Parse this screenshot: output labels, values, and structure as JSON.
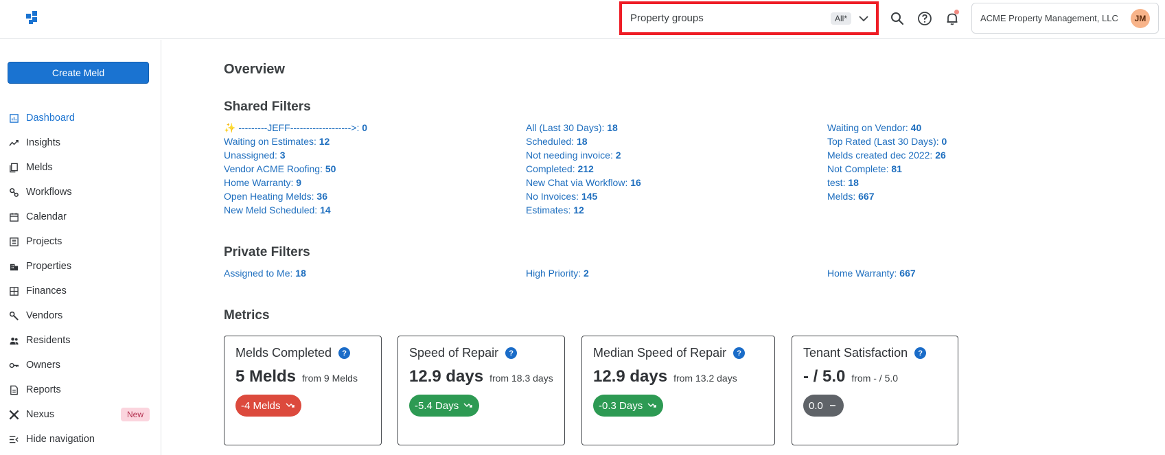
{
  "header": {
    "property_groups_label": "Property groups",
    "property_groups_badge": "All*",
    "account_name": "ACME Property Management, LLC",
    "avatar_initials": "JM"
  },
  "sidebar": {
    "create_label": "Create Meld",
    "items": [
      {
        "label": "Dashboard",
        "icon": "dashboard-icon"
      },
      {
        "label": "Insights",
        "icon": "insights-icon"
      },
      {
        "label": "Melds",
        "icon": "melds-icon"
      },
      {
        "label": "Workflows",
        "icon": "workflows-icon"
      },
      {
        "label": "Calendar",
        "icon": "calendar-icon"
      },
      {
        "label": "Projects",
        "icon": "projects-icon"
      },
      {
        "label": "Properties",
        "icon": "properties-icon"
      },
      {
        "label": "Finances",
        "icon": "finances-icon"
      },
      {
        "label": "Vendors",
        "icon": "vendors-icon"
      },
      {
        "label": "Residents",
        "icon": "residents-icon"
      },
      {
        "label": "Owners",
        "icon": "owners-icon"
      },
      {
        "label": "Reports",
        "icon": "reports-icon"
      },
      {
        "label": "Nexus",
        "icon": "nexus-icon",
        "badge": "New"
      },
      {
        "label": "Hide navigation",
        "icon": "hide-navigation-icon"
      }
    ]
  },
  "main": {
    "overview_title": "Overview",
    "shared_title": "Shared Filters",
    "shared_columns": [
      [
        {
          "label": "✨ ---------JEFF------------------->: ",
          "count": "0"
        },
        {
          "label": "Waiting on Estimates: ",
          "count": "12"
        },
        {
          "label": "Unassigned: ",
          "count": "3"
        },
        {
          "label": "Vendor ACME Roofing: ",
          "count": "50"
        },
        {
          "label": "Home Warranty: ",
          "count": "9"
        },
        {
          "label": "Open Heating Melds: ",
          "count": "36"
        },
        {
          "label": "New Meld Scheduled: ",
          "count": "14"
        }
      ],
      [
        {
          "label": "All (Last 30 Days): ",
          "count": "18"
        },
        {
          "label": "Scheduled: ",
          "count": "18"
        },
        {
          "label": "Not needing invoice: ",
          "count": "2"
        },
        {
          "label": "Completed: ",
          "count": "212"
        },
        {
          "label": "New Chat via Workflow: ",
          "count": "16"
        },
        {
          "label": "No Invoices: ",
          "count": "145"
        },
        {
          "label": "Estimates: ",
          "count": "12"
        }
      ],
      [
        {
          "label": "Waiting on Vendor: ",
          "count": "40"
        },
        {
          "label": "Top Rated (Last 30 Days): ",
          "count": "0"
        },
        {
          "label": "Melds created dec 2022: ",
          "count": "26"
        },
        {
          "label": "Not Complete: ",
          "count": "81"
        },
        {
          "label": "test: ",
          "count": "18"
        },
        {
          "label": "Melds: ",
          "count": "667"
        }
      ]
    ],
    "private_title": "Private Filters",
    "private_columns": [
      [
        {
          "label": "Assigned to Me: ",
          "count": "18"
        }
      ],
      [
        {
          "label": "High Priority: ",
          "count": "2"
        }
      ],
      [
        {
          "label": "Home Warranty: ",
          "count": "667"
        }
      ]
    ],
    "metrics_title": "Metrics",
    "metrics": [
      {
        "title": "Melds Completed",
        "value": "5 Melds",
        "from": "from 9 Melds",
        "delta": "-4 Melds",
        "tone": "red",
        "trend": "down"
      },
      {
        "title": "Speed of Repair",
        "value": "12.9 days",
        "from": "from 18.3 days",
        "delta": "-5.4 Days",
        "tone": "green",
        "trend": "down"
      },
      {
        "title": "Median Speed of Repair",
        "value": "12.9 days",
        "from": "from 13.2 days",
        "delta": "-0.3 Days",
        "tone": "green",
        "trend": "down"
      },
      {
        "title": "Tenant Satisfaction",
        "value": "- / 5.0",
        "from": "from - / 5.0",
        "delta": "0.0",
        "tone": "gray",
        "trend": "flat"
      }
    ]
  },
  "colors": {
    "accent": "#1a73d1",
    "highlight_border": "#ee1c25",
    "negative": "#dc4a3d",
    "positive": "#2d9a53",
    "neutral": "#5f6368"
  }
}
